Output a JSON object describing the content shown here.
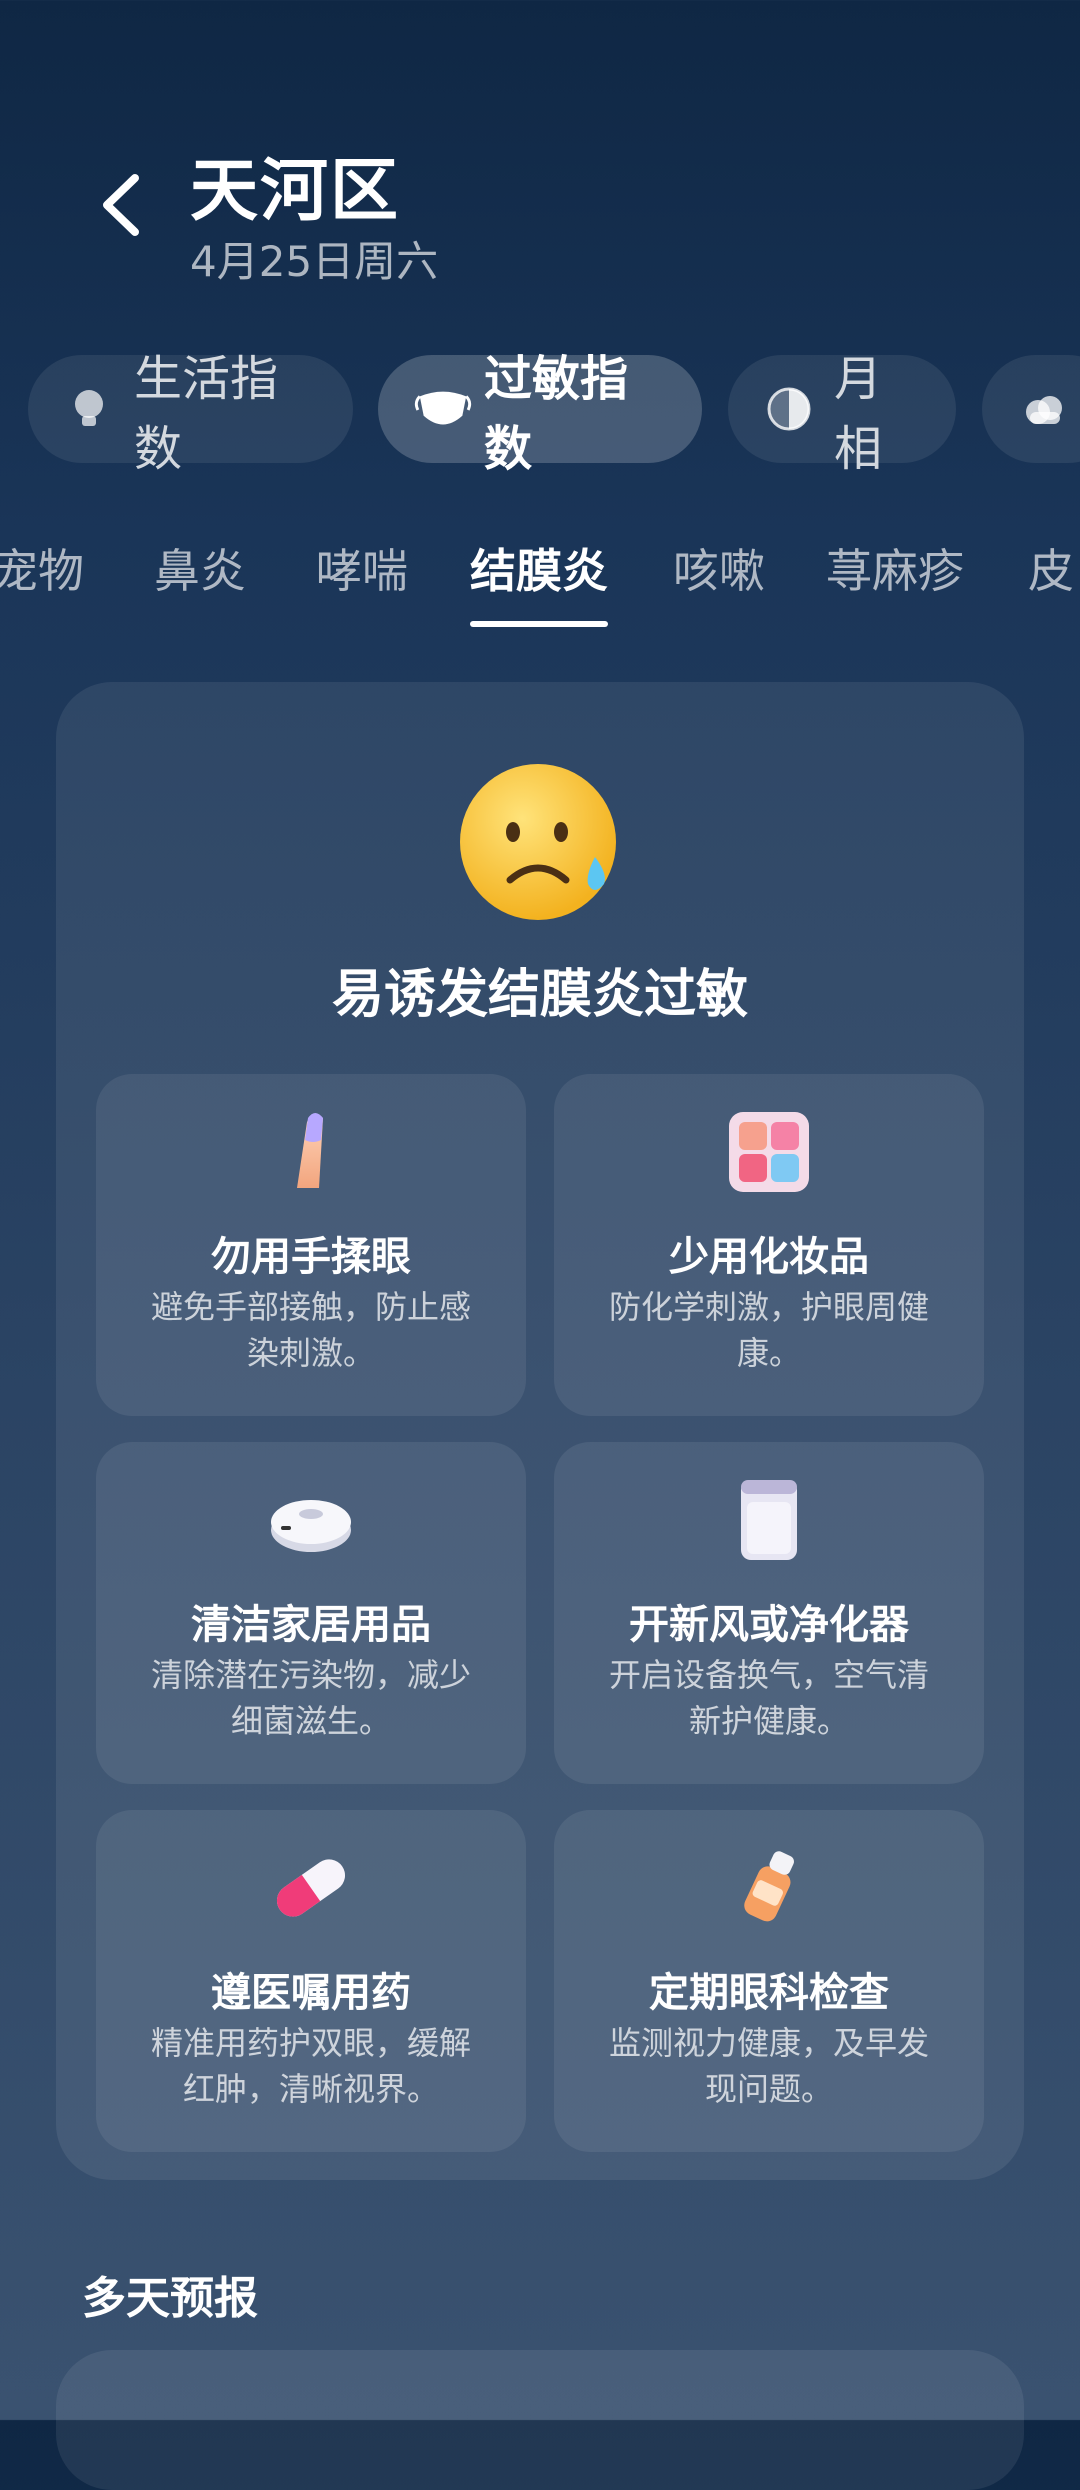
{
  "header": {
    "title": "天河区",
    "date": "4月25日周六"
  },
  "categories": [
    {
      "label": "生活指数",
      "icon": "lightbulb-icon",
      "active": false
    },
    {
      "label": "过敏指数",
      "icon": "mask-icon",
      "active": true
    },
    {
      "label": "月相",
      "icon": "moon-icon",
      "active": false
    },
    {
      "label": "",
      "icon": "cloud-icon",
      "active": false
    }
  ],
  "subtabs": [
    "宠物",
    "鼻炎",
    "哮喘",
    "结膜炎",
    "咳嗽",
    "荨麻疹",
    "皮"
  ],
  "active_subtab": "结膜炎",
  "verdict": {
    "icon": "worried-face-icon",
    "text": "易诱发结膜炎过敏"
  },
  "tips": [
    {
      "icon": "finger-icon",
      "title": "勿用手揉眼",
      "desc": "避免手部接触，防止感染刺激。"
    },
    {
      "icon": "makeup-palette-icon",
      "title": "少用化妆品",
      "desc": "防化学刺激，护眼周健康。"
    },
    {
      "icon": "robot-vacuum-icon",
      "title": "清洁家居用品",
      "desc": "清除潜在污染物，减少细菌滋生。"
    },
    {
      "icon": "air-purifier-icon",
      "title": "开新风或净化器",
      "desc": "开启设备换气，空气清新护健康。"
    },
    {
      "icon": "pill-icon",
      "title": "遵医嘱用药",
      "desc": "精准用药护双眼，缓解红肿，清晰视界。"
    },
    {
      "icon": "eye-drops-icon",
      "title": "定期眼科检查",
      "desc": "监测视力健康，及早发现问题。"
    }
  ],
  "forecast_title": "多天预报",
  "colors": {
    "background_top": "#0f2744",
    "background_bottom": "#3a5270",
    "face_yellow": "#f7c531"
  }
}
